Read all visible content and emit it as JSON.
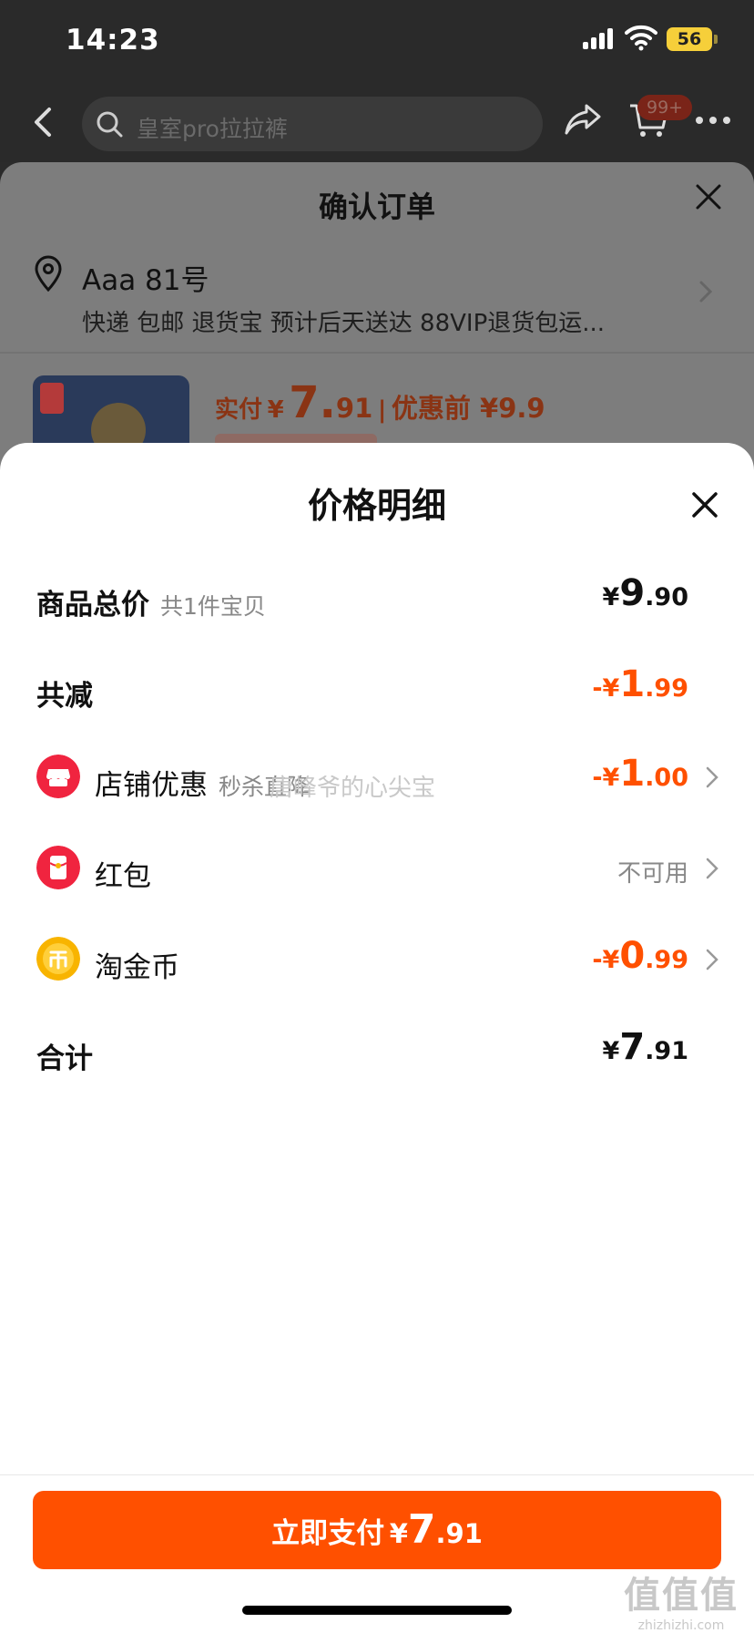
{
  "status_bar": {
    "time": "14:23",
    "battery": "56"
  },
  "top_nav": {
    "search_placeholder": "皇室pro拉拉裤",
    "cart_badge": "99+"
  },
  "order_sheet": {
    "title": "确认订单",
    "address_name": "Aaa 81号",
    "address_line": "快递 包邮 退货宝 预计后天送达 88VIP退货包运...",
    "paid_label": "实付",
    "paid_currency": "¥",
    "paid_int": "7.",
    "paid_dec": "91",
    "separator": "|",
    "original_price": "优惠前 ¥9.9"
  },
  "detail": {
    "title": "价格明细",
    "watermark": "唐峰爷的心尖宝",
    "rows": {
      "subtotal": {
        "label": "商品总价",
        "sub": "共1件宝贝",
        "cur": "¥",
        "int": "9",
        "dec": ".90"
      },
      "discount": {
        "label": "共减",
        "cur": "-¥",
        "int": "1",
        "dec": ".99"
      },
      "shop": {
        "label": "店铺优惠",
        "sub": "秒杀直降",
        "cur": "-¥",
        "int": "1",
        "dec": ".00",
        "icon": "shop-icon"
      },
      "redpacket": {
        "label": "红包",
        "value": "不可用",
        "icon": "red-packet-icon"
      },
      "coins": {
        "label": "淘金币",
        "cur": "-¥",
        "int": "0",
        "dec": ".99",
        "icon": "coin-icon"
      },
      "total": {
        "label": "合计",
        "cur": "¥",
        "int": "7",
        "dec": ".91"
      }
    }
  },
  "pay_button": {
    "label": "立即支付",
    "cur": "¥",
    "int": "7",
    "dec": ".91"
  },
  "corner_mark": {
    "main": "值值值",
    "sub": "zhizhizhi.com"
  },
  "colors": {
    "accent": "#ff5000",
    "text": "#111111",
    "muted": "#888888"
  }
}
